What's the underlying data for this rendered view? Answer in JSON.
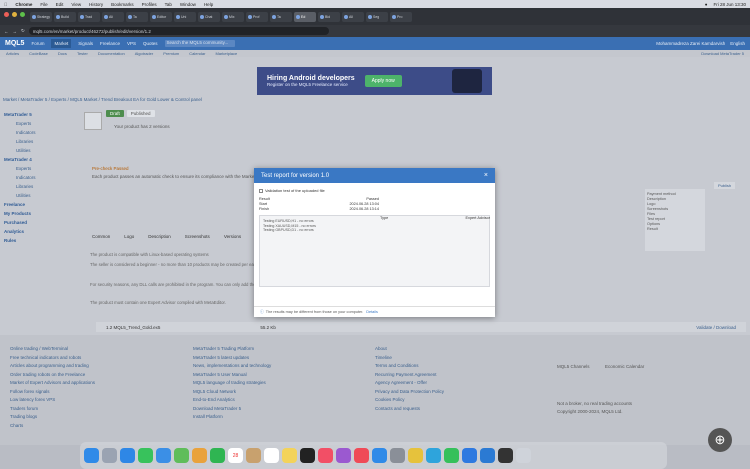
{
  "menubar": {
    "apple": "",
    "items": [
      "Chrome",
      "File",
      "Edit",
      "View",
      "History",
      "Bookmarks",
      "Profiles",
      "Tab",
      "Window",
      "Help"
    ],
    "clock": "Fri 28 Jun 13:30"
  },
  "browser": {
    "tabs": [
      "Strategy",
      "Build",
      "Trad",
      "Ali",
      "Ta",
      "Editor",
      "Uni",
      "Chat",
      "Mix",
      "Prof",
      "Ta",
      "Ed",
      "Bid",
      "All",
      "Seg",
      "Pro"
    ],
    "active_tab_index": 11,
    "url": "mql5.com/en/market/product/46272/publish/edit/version/1.2"
  },
  "site": {
    "logo": "MQL5",
    "menu": [
      "Forum",
      "Market",
      "Signals",
      "Freelance",
      "VPS",
      "Quotes"
    ],
    "active_menu_index": 1,
    "search_placeholder": "Search the MQL5 community...",
    "user_name": "Mohammadreza Zarei Kamdarvish",
    "language": "English",
    "subnav": [
      "Articles",
      "CodeBase",
      "Docs",
      "Tester",
      "Documentation",
      "Algotrader",
      "Premium",
      "Calendar",
      "Marketplace"
    ],
    "subnav_right": "Download MetaTrader 5"
  },
  "banner": {
    "title": "Hiring Android developers",
    "subtitle": "Register on the MQL5 Freelance service",
    "cta": "Apply now"
  },
  "breadcrumb": "Market / MetaTrader 5 / Experts / MQL5 Market / Trend Breakout EA for Gold Lower & Control panel",
  "leftnav": [
    {
      "group": "MetaTrader 5",
      "items": [
        "Experts",
        "Indicators",
        "Libraries",
        "Utilities"
      ]
    },
    {
      "group": "MetaTrader 4",
      "items": [
        "Experts",
        "Indicators",
        "Libraries",
        "Utilities"
      ]
    },
    {
      "group": "Freelance",
      "items": []
    },
    {
      "group": "My Products",
      "items": []
    },
    {
      "group": "Purchased",
      "items": []
    },
    {
      "group": "Analytics",
      "items": []
    },
    {
      "group": "Rules",
      "items": []
    }
  ],
  "content": {
    "pub_tabs": [
      "Draft",
      "Published"
    ],
    "version_line": "Your product has 2 versions",
    "notice_title": "Pre-check Passed",
    "notice_text": "Each product passes an automatic check to ensure its compliance with the Market rules.",
    "tabs": [
      "Common",
      "Logo",
      "Description",
      "Screenshots",
      "Versions"
    ],
    "p1": "The product is compatible with Linux-based operating systems",
    "p2": "The seller is considered a beginner - no more than 10 products may be created per each category.",
    "p3": "For security reasons, any DLL calls are prohibited in the program. You can only add the necessary files using the #resource directive, but keep in mind...",
    "p4": "The product must contain one Expert Advisor compiled with MetaEditor.",
    "file_name": "1.2 MQL5_Trend_Gold.ex5",
    "file_size": "55.2 Kb",
    "file_action": "Validate / Download"
  },
  "sidepanel": {
    "publish_btn": "Publish",
    "items": [
      "Payment method",
      "Description",
      "Logo",
      "Screenshots",
      "Files",
      "Test report",
      "Options",
      "Result"
    ]
  },
  "modal": {
    "title": "Test report for version 1.0",
    "close": "×",
    "report_label": "Validation test of the uploaded file",
    "rows": [
      {
        "k": "Result",
        "v": "Passed"
      },
      {
        "k": "Start",
        "v": "2024.06.28 13:04"
      },
      {
        "k": "Finish",
        "v": "2024.06.28 13:14"
      }
    ],
    "right_key": "Type",
    "right_val": "Expert Advisor",
    "log": [
      "Testing EURUSD,H1 - no errors",
      "Testing XAUUSD,M15 - no errors",
      "Testing GBPUSD,D1 - no errors"
    ],
    "footer_text": "The results may be different from those on your computer.",
    "footer_link": "Details"
  },
  "footer": {
    "col1": [
      "Online trading / WebTerminal",
      "Free technical indicators and robots",
      "Articles about programming and trading",
      "Order trading robots on the Freelance",
      "Market of Expert Advisors and applications",
      "Follow forex signals",
      "Low latency forex VPS",
      "Traders forum",
      "Trading blogs",
      "Charts"
    ],
    "col2": [
      "MetaTrader 5 Trading Platform",
      "MetaTrader 5 latest updates",
      "News, implementations and technology",
      "MetaTrader 5 User Manual",
      "MQL5 language of trading strategies",
      "MQL5 Cloud Network",
      "End-to-End Analytics",
      "Download MetaTrader 5",
      "Install Platform"
    ],
    "col3": [
      "About",
      "Timeline",
      "Terms and Conditions",
      "Recurring Payment Agreement",
      "Agency Agreement - Offer",
      "Privacy and Data Protection Policy",
      "Cookies Policy",
      "Contacts and requests"
    ],
    "col4_title1": "MQL5 Channels",
    "col4_title2": "Economic Calendar",
    "col4_tail": "Not a broker, no real trading accounts",
    "copyright": "Copyright 2000-2024, MQL5 Ltd."
  },
  "dock": {
    "apps": [
      "Finder",
      "Launchpad",
      "Safari",
      "Messages",
      "Mail",
      "Maps",
      "Photos",
      "FaceTime",
      "Calendar",
      "Contacts",
      "Reminders",
      "Notes",
      "TV",
      "Music",
      "Podcasts",
      "News",
      "App Store",
      "Settings",
      "Chrome",
      "Telegram",
      "WhatsApp",
      "Xcode",
      "VS Code",
      "Terminal",
      "Trash"
    ],
    "colors": [
      "#2f8ae8",
      "#9aa3b2",
      "#2e87e6",
      "#38c25c",
      "#3b8fe6",
      "#5fbd5a",
      "#e9a23c",
      "#2fb552",
      "#ffffff",
      "#c8a16e",
      "#ffffff",
      "#f3d35a",
      "#222222",
      "#f24f66",
      "#9b59d0",
      "#ef4a57",
      "#2f8ae8",
      "#8a8f98",
      "#e6c23c",
      "#2ea4dc",
      "#35c05b",
      "#2e79e0",
      "#2b7ad3",
      "#333333",
      "#cfd3da"
    ],
    "calendar_day": "28"
  }
}
